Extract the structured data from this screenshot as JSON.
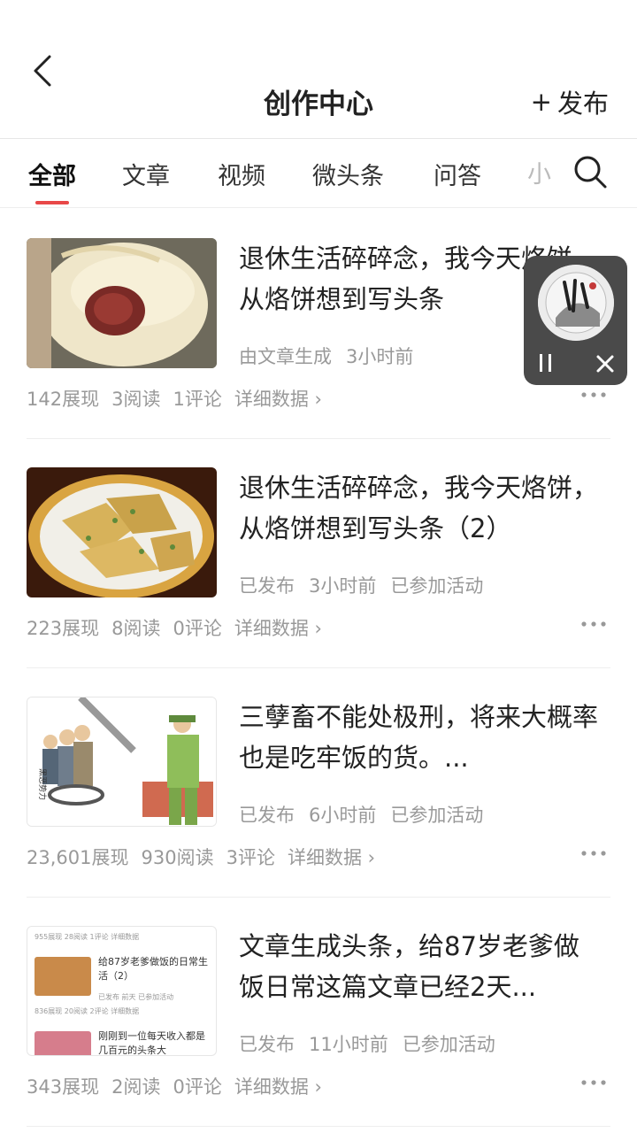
{
  "header": {
    "title": "创作中心",
    "publish_label": "发布",
    "publish_plus": "+"
  },
  "tabs": [
    "全部",
    "文章",
    "视频",
    "微头条",
    "问答",
    "小"
  ],
  "cards": [
    {
      "title": "退休生活碎碎念，我今天烙饼，从烙饼想到写头条",
      "meta": [
        "由文章生成",
        "3小时前"
      ],
      "stats": [
        "142展现",
        "3阅读",
        "1评论",
        "详细数据 ›"
      ]
    },
    {
      "title": "退休生活碎碎念，我今天烙饼，从烙饼想到写头条（2）",
      "meta": [
        "已发布",
        "3小时前",
        "已参加活动"
      ],
      "stats": [
        "223展现",
        "8阅读",
        "0评论",
        "详细数据 ›"
      ]
    },
    {
      "title": "三孽畜不能处极刑，将来大概率也是吃牢饭的货。...",
      "meta": [
        "已发布",
        "6小时前",
        "已参加活动"
      ],
      "stats": [
        "23,601展现",
        "930阅读",
        "3评论",
        "详细数据 ›"
      ]
    },
    {
      "title": "文章生成头条，给87岁老爹做饭日常这篇文章已经2天...",
      "meta": [
        "已发布",
        "11小时前",
        "已参加活动"
      ],
      "stats": [
        "343展现",
        "2阅读",
        "0评论",
        "详细数据 ›"
      ]
    }
  ],
  "thumb4": {
    "row1_stats": "955展现 28阅读 1评论 详细数据",
    "row1_title": "给87岁老爹做饭的日常生活（2）",
    "row1_meta": "已发布 前天 已参加活动",
    "row2_stats": "836展现 20阅读 2评论 详细数据",
    "row2_title": "刚刚到一位每天收入都是几百元的头条大"
  },
  "colors": {
    "accent": "#e84848",
    "widget_bg": "#4a4a4a"
  }
}
